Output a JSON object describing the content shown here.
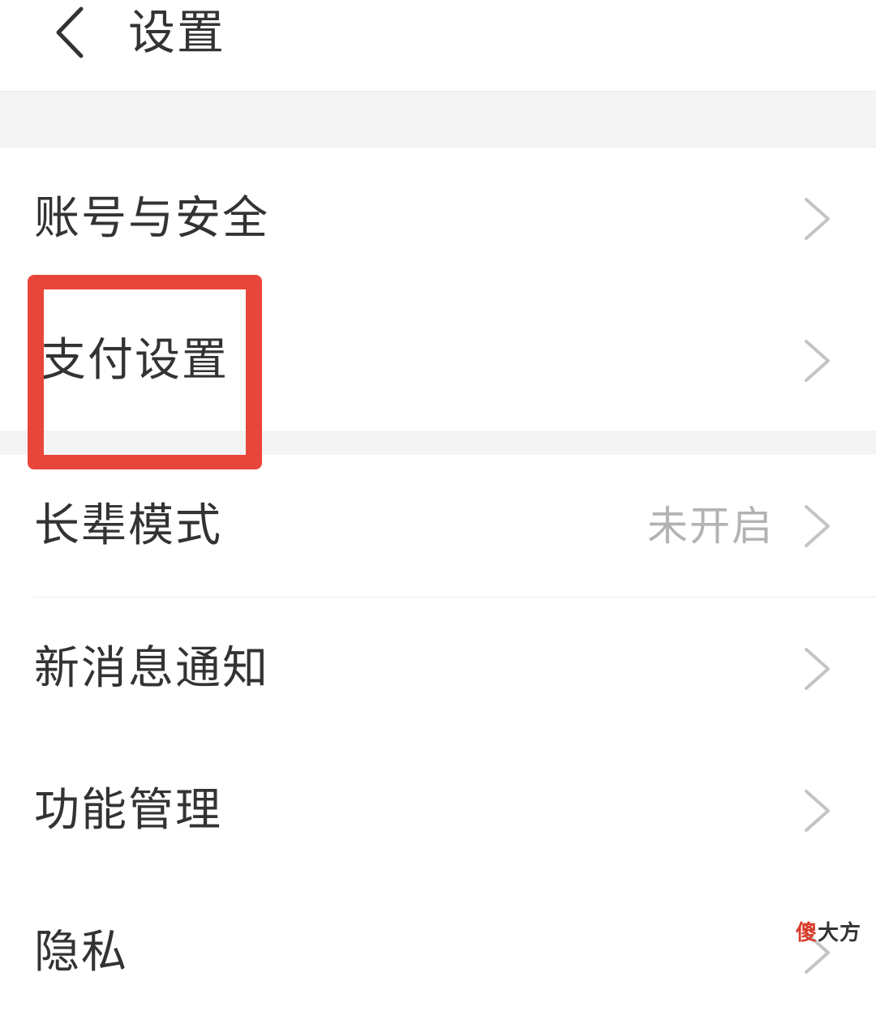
{
  "header": {
    "title": "设置",
    "back_icon": "chevron-left-icon"
  },
  "settings": {
    "items": [
      {
        "label": "账号与安全",
        "value": "",
        "chevron_icon": "chevron-right-icon"
      },
      {
        "label": "支付设置",
        "value": "",
        "chevron_icon": "chevron-right-icon"
      },
      {
        "label": "长辈模式",
        "value": "未开启",
        "chevron_icon": "chevron-right-icon"
      },
      {
        "label": "新消息通知",
        "value": "",
        "chevron_icon": "chevron-right-icon"
      },
      {
        "label": "功能管理",
        "value": "",
        "chevron_icon": "chevron-right-icon"
      },
      {
        "label": "隐私",
        "value": "",
        "chevron_icon": "chevron-right-icon"
      }
    ]
  },
  "annotation": {
    "highlight_color": "#e8463a",
    "highlighted_item": "支付设置"
  },
  "watermark": {
    "accent": "傻",
    "rest": "大方",
    "accent_color": "#d93a2b"
  },
  "colors": {
    "text_primary": "#333333",
    "text_secondary": "#b3b3b3",
    "chevron": "#c4c4c4",
    "section_gap": "#f4f4f4",
    "divider": "#ececec"
  }
}
